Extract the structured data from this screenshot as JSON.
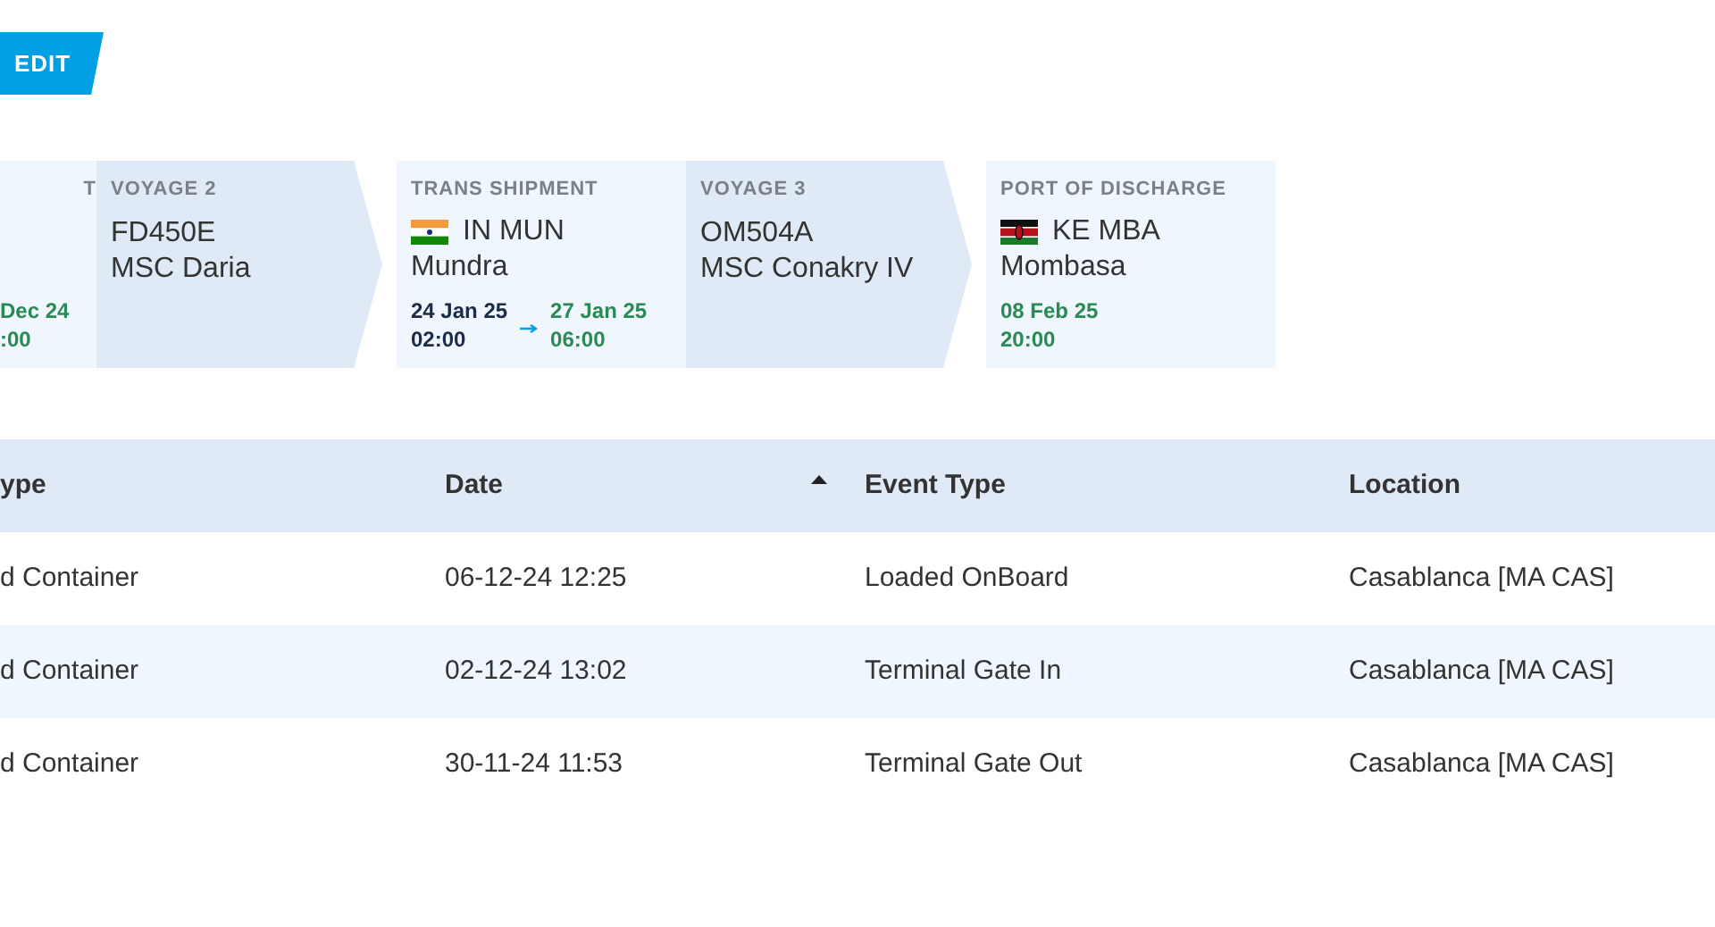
{
  "edit_button": {
    "label": "EDIT"
  },
  "route": [
    {
      "kind": "port",
      "label": "T",
      "arrival": {
        "date": "Dec 24",
        "time": ":00"
      }
    },
    {
      "kind": "voyage",
      "label": "VOYAGE 2",
      "code": "FD450E",
      "vessel": "MSC Daria"
    },
    {
      "kind": "port",
      "label": "TRANS SHIPMENT",
      "flag": {
        "kind": "india"
      },
      "port_code": "IN MUN",
      "port_name": "Mundra",
      "departure": {
        "date": "24 Jan 25",
        "time": "02:00"
      },
      "arrival": {
        "date": "27 Jan 25",
        "time": "06:00"
      }
    },
    {
      "kind": "voyage",
      "label": "VOYAGE 3",
      "code": "OM504A",
      "vessel": "MSC Conakry IV"
    },
    {
      "kind": "port",
      "label": "PORT OF DISCHARGE",
      "flag": {
        "kind": "kenya"
      },
      "port_code": "KE MBA",
      "port_name": "Mombasa",
      "arrival": {
        "date": "08 Feb 25",
        "time": "20:00"
      }
    }
  ],
  "table": {
    "columns": [
      {
        "label": "ype",
        "sorted": false
      },
      {
        "label": "Date",
        "sorted": true
      },
      {
        "label": "Event Type",
        "sorted": false
      },
      {
        "label": "Location",
        "sorted": false
      }
    ],
    "rows": [
      [
        "d Container",
        "06-12-24 12:25",
        "Loaded OnBoard",
        "Casablanca [MA CAS]"
      ],
      [
        "d Container",
        "02-12-24 13:02",
        "Terminal Gate In",
        "Casablanca [MA CAS]"
      ],
      [
        "d Container",
        "30-11-24 11:53",
        "Terminal Gate Out",
        "Casablanca [MA CAS]"
      ]
    ]
  }
}
